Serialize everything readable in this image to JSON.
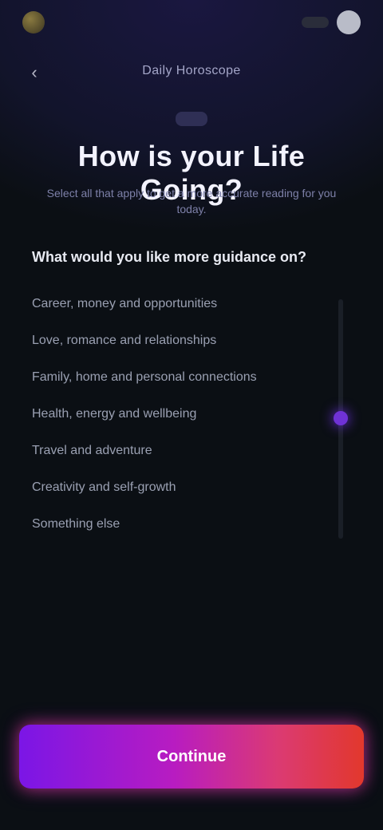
{
  "status": {
    "app_name": "",
    "time": ""
  },
  "header": {
    "subtitle": "Daily Horoscope"
  },
  "main": {
    "title": "How is your Life Going?",
    "description": "Select all that apply to get a more accurate reading for you today.",
    "question": "What would you like more guidance on?",
    "options": [
      "Career, money and opportunities",
      "Love, romance and relationships",
      "Family, home and personal connections",
      "Health, energy and wellbeing",
      "Travel and adventure",
      "Creativity and self-growth",
      "Something else"
    ]
  },
  "cta": {
    "label": "Continue"
  },
  "colors": {
    "accent_start": "#7b16e6",
    "accent_mid": "#db3a73",
    "accent_end": "#e2382c"
  },
  "icons": {
    "back": "chevron-left-icon",
    "top": "sparkle-icon"
  }
}
